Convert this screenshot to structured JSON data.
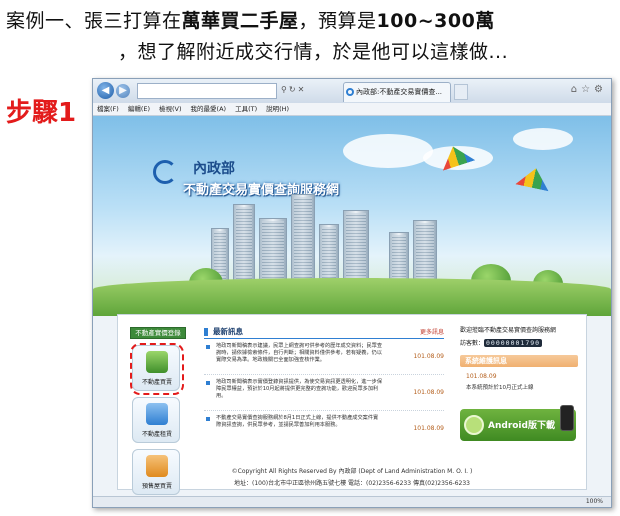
{
  "slide": {
    "title_line1_a": "案例一、張三打算在",
    "title_line1_b": "萬華買二手屋",
    "title_line1_c": "，預算是",
    "title_line1_d": "100~300萬",
    "title_line2": "，想了解附近成交行情，於是他可以這樣做...",
    "step_label": "步驟1",
    "step_color": "#e31b1b"
  },
  "browser": {
    "url": "",
    "tab_title": "內政部:不動產交易實價查...",
    "menu": [
      "檔案(F)",
      "編輯(E)",
      "檢視(V)",
      "我的最愛(A)",
      "工具(T)",
      "說明(H)"
    ],
    "zoom": "100%"
  },
  "site": {
    "dept": "內政部",
    "service_name": "不動產交易實價查詢服務網",
    "sidebar_title": "不動產實價登錄",
    "sidebar": [
      {
        "label": "不動產買賣",
        "icon": "house-sale-icon",
        "color": "#3f8f2b"
      },
      {
        "label": "不動產租賃",
        "icon": "rent-icon",
        "color": "#2f7fd2"
      },
      {
        "label": "預售屋買賣",
        "icon": "presale-crane-icon",
        "color": "#e08a1e"
      }
    ],
    "news_title": "最新訊息",
    "news_more": "更多訊息",
    "news": [
      {
        "text": "地政司新聞稿表示建議，民眾上網查詢可供參考的歷年成交資料；民眾查詢時，請依據檢索條件，自行判斷；相關資料僅供參考，若有疑義，仍以實際交易為準。地政機關已全面加強查核作業。",
        "date": "101.08.09"
      },
      {
        "text": "地政司新聞稿表示實價登錄資訊提供，為使交易資訊更透明化，進一步保障民眾權益，預計於10月起將提供更完整的查詢功能，歡迎民眾多加利用。",
        "date": "101.08.09"
      },
      {
        "text": "不動產交易實價查詢服務網於8月1日正式上線，提供不動產成交案件實際資訊查詢，供民眾參考，並請民眾善加利用本服務。",
        "date": "101.08.09"
      }
    ],
    "welcome": "歡迎蒞臨不動產交易實價查詢服務網",
    "visitor_label": "訪客數：",
    "visitor_count": "00000001790",
    "system_title": "系統維護訊息",
    "system_date": "101.08.09",
    "system_msg": "本系統預計於10月正式上線",
    "android_label": "Android版下載",
    "copyright": "©Copyright All Rights Reserved By 內政部 (Dept of Land Administration M. O. I. )",
    "address": "地址：(100)台北市中正區徐州路五號七樓 電話：(02)2356-6233 傳真(02)2356-6233"
  }
}
